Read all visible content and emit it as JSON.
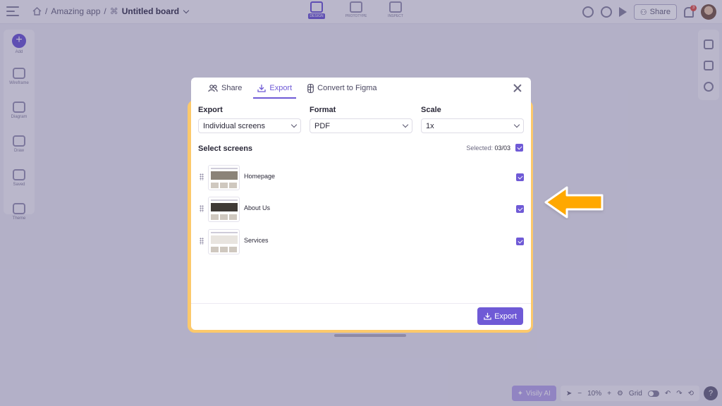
{
  "app": {
    "breadcrumb": {
      "project": "Amazing app",
      "separator": "/",
      "board": "Untitled board"
    },
    "modes": [
      {
        "label": "DESIGN",
        "active": true,
        "icon": "design-icon"
      },
      {
        "label": "PROTOTYPE",
        "active": false,
        "icon": "prototype-icon"
      },
      {
        "label": "INSPECT",
        "active": false,
        "icon": "inspect-icon"
      }
    ],
    "share_label": "Share",
    "notification_count": "3",
    "left_rail": [
      {
        "label": "Add",
        "icon": "plus-icon"
      },
      {
        "label": "Wireframe",
        "icon": "wireframe-icon"
      },
      {
        "label": "Diagram",
        "icon": "diagram-icon"
      },
      {
        "label": "Draw",
        "icon": "draw-icon"
      },
      {
        "label": "Saved",
        "icon": "saved-icon"
      },
      {
        "label": "Theme",
        "icon": "theme-icon"
      }
    ],
    "bottom": {
      "ai_label": "Visily AI",
      "zoom": "10%",
      "grid_label": "Grid",
      "help": "?"
    }
  },
  "modal": {
    "tabs": [
      {
        "label": "Share",
        "icon": "users-icon",
        "active": false
      },
      {
        "label": "Export",
        "icon": "download-icon",
        "active": true
      },
      {
        "label": "Convert to Figma",
        "icon": "figma-icon",
        "active": false
      }
    ],
    "export_label": "Export",
    "export_value": "Individual screens",
    "format_label": "Format",
    "format_value": "PDF",
    "scale_label": "Scale",
    "scale_value": "1x",
    "section_title": "Select screens",
    "selected_prefix": "Selected:",
    "selected_count": "03/03",
    "screens": [
      {
        "name": "Homepage",
        "checked": true
      },
      {
        "name": "About Us",
        "checked": true
      },
      {
        "name": "Services",
        "checked": true
      }
    ],
    "export_button": "Export"
  },
  "colors": {
    "accent": "#6f5ad6",
    "highlight_border": "#fcc96b",
    "arrow": "#ffa800"
  }
}
